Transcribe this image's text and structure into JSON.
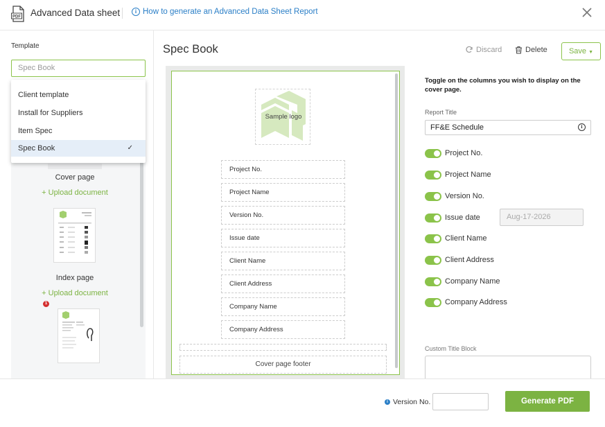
{
  "header": {
    "title": "Advanced Data sheet",
    "help_link": "How to generate an Advanced Data Sheet Report",
    "pdf_icon_text": "PDF"
  },
  "left": {
    "template_label": "Template",
    "template_placeholder": "Spec Book",
    "dropdown_options": [
      "Client template",
      "Install for Suppliers",
      "Item Spec",
      "Spec Book"
    ],
    "selected_option": "Spec Book",
    "pages": [
      {
        "name": "Cover page",
        "upload": "+ Upload document"
      },
      {
        "name": "Index page",
        "upload": "+ Upload document"
      }
    ],
    "badge_count": "1"
  },
  "center": {
    "title": "Spec Book",
    "logo_placeholder": "Sample logo",
    "fields": [
      "Project No.",
      "Project Name",
      "Version No.",
      "Issue date",
      "Client Name",
      "Client Address",
      "Company Name",
      "Company Address"
    ],
    "footer_placeholder": "Cover page footer"
  },
  "toolbar": {
    "discard": "Discard",
    "delete": "Delete",
    "save": "Save"
  },
  "settings": {
    "instruction": "Toggle on the columns you wish to display on the cover page.",
    "report_title_label": "Report Title",
    "report_title_value": "FF&E Schedule",
    "toggles": [
      {
        "label": "Project No.",
        "on": true
      },
      {
        "label": "Project Name",
        "on": true
      },
      {
        "label": "Version No.",
        "on": true
      },
      {
        "label": "Issue date",
        "on": true
      },
      {
        "label": "Client Name",
        "on": true
      },
      {
        "label": "Client Address",
        "on": true
      },
      {
        "label": "Company Name",
        "on": true
      },
      {
        "label": "Company Address",
        "on": true
      }
    ],
    "issue_date_value": "Aug-17-2026",
    "custom_title_label": "Custom Title Block"
  },
  "footer": {
    "version_label": "Version No.",
    "generate": "Generate PDF"
  },
  "colors": {
    "accent": "#8bc34a",
    "accent_dark": "#7cb342",
    "link": "#2b7fc7",
    "selected_bg": "#e5eef8"
  }
}
